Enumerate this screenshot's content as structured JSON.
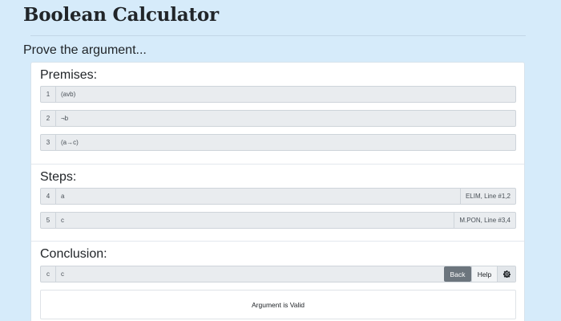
{
  "app": {
    "title": "Boolean Calculator",
    "subtitle": "Prove the argument..."
  },
  "premises": {
    "heading": "Premises:",
    "rows": [
      {
        "num": "1",
        "expr": "(avb)"
      },
      {
        "num": "2",
        "expr": "¬b"
      },
      {
        "num": "3",
        "expr": "(a→c)"
      }
    ]
  },
  "steps": {
    "heading": "Steps:",
    "rows": [
      {
        "num": "4",
        "expr": "a",
        "rule": "ELIM, Line #1,2"
      },
      {
        "num": "5",
        "expr": "c",
        "rule": "M.PON, Line #3,4"
      }
    ]
  },
  "conclusion": {
    "heading": "Conclusion:",
    "label": "c",
    "expr": "c",
    "back_label": "Back",
    "help_label": "Help",
    "settings_icon": "gear-icon"
  },
  "result": {
    "text": "Argument is Valid"
  },
  "colors": {
    "background": "#d6ebfa",
    "back_button": "#6c757d",
    "row_fill": "#e9ecef"
  }
}
